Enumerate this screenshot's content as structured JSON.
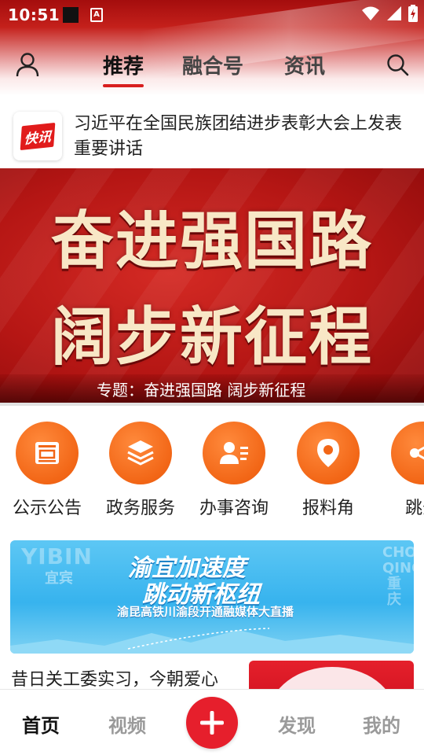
{
  "status_bar": {
    "time": "10:51",
    "a_icon_letter": "A",
    "icons": [
      "square-notification-icon",
      "a-notification-icon",
      "wifi-icon",
      "signal-icon",
      "battery-charging-icon"
    ]
  },
  "top_nav": {
    "tabs": [
      {
        "label": "推荐",
        "active": true
      },
      {
        "label": "融合号",
        "active": false
      },
      {
        "label": "资讯",
        "active": false
      }
    ],
    "accent_color": "#d81e1e",
    "icons": [
      "user-icon",
      "search-icon"
    ]
  },
  "flash_news": {
    "badge": "快讯",
    "text": "习近平在全国民族团结进步表彰大会上发表重要讲话"
  },
  "banner": {
    "line1": "奋进强国路",
    "line2": "阔步新征程",
    "caption": "专题：奋进强国路 阔步新征程"
  },
  "services": {
    "color": "#f26616",
    "items": [
      {
        "label": "公示公告",
        "icon": "notice-board-icon"
      },
      {
        "label": "政务服务",
        "icon": "layers-icon"
      },
      {
        "label": "办事咨询",
        "icon": "person-list-icon"
      },
      {
        "label": "报料角",
        "icon": "location-pin-icon"
      },
      {
        "label": "跳蚤",
        "icon": "share-nodes-icon"
      }
    ]
  },
  "promo": {
    "left_text": "YIBIN",
    "left_cn": "宜宾",
    "right_text": "CHONG QING 重庆",
    "title1": "渝宜加速度",
    "title2": "跳动新枢纽",
    "subtitle": "渝昆高铁川渝段开通融媒体大直播"
  },
  "article": {
    "title": "昔日关工委实习，今朝爱心"
  },
  "bottom_nav": {
    "items": [
      {
        "label": "首页",
        "active": true
      },
      {
        "label": "视频",
        "active": false
      },
      {
        "label": "发现",
        "active": false
      },
      {
        "label": "我的",
        "active": false
      }
    ],
    "center_icon": "plus-icon",
    "center_color": "#e61f2c"
  }
}
